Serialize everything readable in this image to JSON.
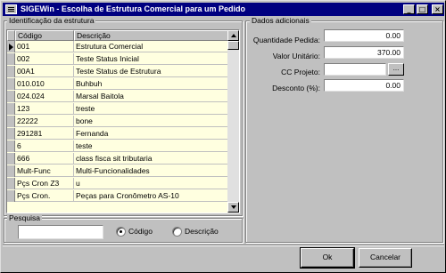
{
  "window": {
    "title": "SIGEWin -  Escolha de Estrutura Comercial para um Pedido",
    "controls": {
      "minimize": "_",
      "maximize": "□",
      "close": "×"
    }
  },
  "structure_group": {
    "label": "Identificação da estrutura",
    "columns": [
      "Código",
      "Descrição"
    ],
    "rows": [
      {
        "codigo": "001",
        "descricao": "Estrutura Comercial"
      },
      {
        "codigo": "002",
        "descricao": "Teste Status Inicial"
      },
      {
        "codigo": "00A1",
        "descricao": "Teste Status de Estrutura"
      },
      {
        "codigo": "010.010",
        "descricao": "Buhbuh"
      },
      {
        "codigo": "024.024",
        "descricao": "Marsal Baitola"
      },
      {
        "codigo": "123",
        "descricao": "treste"
      },
      {
        "codigo": "22222",
        "descricao": "bone"
      },
      {
        "codigo": "291281",
        "descricao": "Fernanda"
      },
      {
        "codigo": "6",
        "descricao": "teste"
      },
      {
        "codigo": "666",
        "descricao": "class fisca sit tributaria"
      },
      {
        "codigo": "Mult-Func",
        "descricao": "Multi-Funcionalidades"
      },
      {
        "codigo": "Pçs Cron Z3",
        "descricao": "u"
      },
      {
        "codigo": "Pçs Cron.",
        "descricao": "Peças para Cronômetro AS-10"
      }
    ]
  },
  "search_group": {
    "label": "Pesquisa",
    "input_value": "",
    "options": [
      {
        "label": "Código",
        "selected": true
      },
      {
        "label": "Descrição",
        "selected": false
      }
    ]
  },
  "details_group": {
    "label": "Dados adicionais",
    "fields": {
      "quantidade": {
        "label": "Quantidade Pedida:",
        "value": "0.00"
      },
      "valor": {
        "label": "Valor Unitário:",
        "value": "370.00"
      },
      "cc_projeto": {
        "label": "CC Projeto:",
        "value": "",
        "button": "..."
      },
      "desconto": {
        "label": "Desconto (%):",
        "value": "0.00"
      }
    }
  },
  "buttons": {
    "ok": "Ok",
    "cancel": "Cancelar"
  }
}
